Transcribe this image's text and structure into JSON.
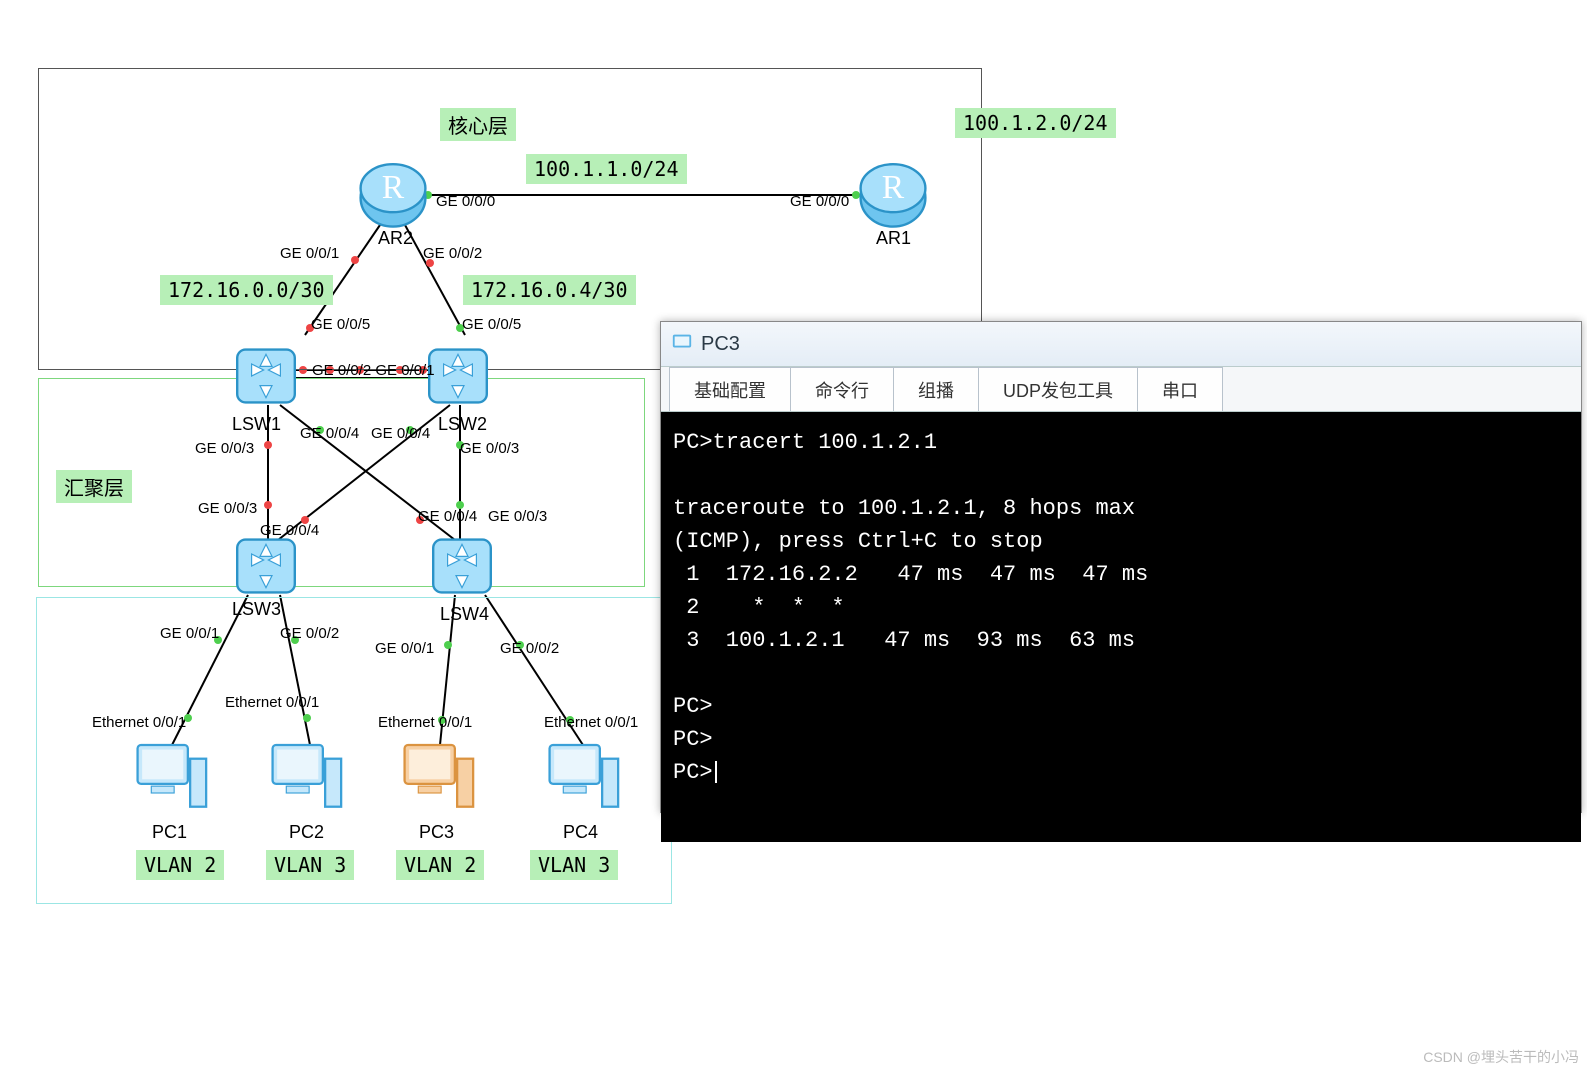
{
  "layers": {
    "core": "核心层",
    "aggregation": "汇聚层"
  },
  "subnets": {
    "ar1_lan": "100.1.2.0/24",
    "ar1_ar2": "100.1.1.0/24",
    "ar2_lsw1": "172.16.0.0/30",
    "ar2_lsw2": "172.16.0.4/30"
  },
  "devices": {
    "ar1": "AR1",
    "ar2": "AR2",
    "lsw1": "LSW1",
    "lsw2": "LSW2",
    "lsw3": "LSW3",
    "lsw4": "LSW4",
    "pc1": "PC1",
    "pc2": "PC2",
    "pc3": "PC3",
    "pc4": "PC4"
  },
  "vlans": {
    "pc1": "VLAN 2",
    "pc2": "VLAN 3",
    "pc3": "VLAN 2",
    "pc4": "VLAN 3"
  },
  "ports": {
    "ar2_ge000": "GE 0/0/0",
    "ar1_ge000": "GE 0/0/0",
    "ar2_ge001": "GE 0/0/1",
    "ar2_ge002": "GE 0/0/2",
    "lsw1_ge005": "GE 0/0/5",
    "lsw2_ge005": "GE 0/0/5",
    "lsw1_ge001": "GE 0/0/1",
    "lsw2_ge001": "GE 0/0/1",
    "lsw1_ge003": "GE 0/0/3",
    "lsw1_ge004": "GE 0/0/4",
    "lsw2_ge003": "GE 0/0/3",
    "lsw2_ge004": "GE 0/0/4",
    "lsw3_ge003": "GE 0/0/3",
    "lsw3_ge004": "GE 0/0/4",
    "lsw4_ge003": "GE 0/0/3",
    "lsw4_ge004": "GE 0/0/4",
    "lsw3_ge001": "GE 0/0/1",
    "lsw3_ge002": "GE 0/0/2",
    "lsw4_ge001": "GE 0/0/1",
    "lsw4_ge002": "GE 0/0/2",
    "pc1_e001": "Ethernet 0/0/1",
    "pc2_e001": "Ethernet 0/0/1",
    "pc3_e001": "Ethernet 0/0/1",
    "pc4_e001": "Ethernet 0/0/1",
    "mid_link": "GE 0/0/2 GE 0/0/1"
  },
  "terminal": {
    "title": "PC3",
    "tabs": [
      "基础配置",
      "命令行",
      "组播",
      "UDP发包工具",
      "串口"
    ],
    "lines": [
      "PC>tracert 100.1.2.1",
      "",
      "traceroute to 100.1.2.1, 8 hops max",
      "(ICMP), press Ctrl+C to stop",
      " 1  172.16.2.2   47 ms  47 ms  47 ms",
      " 2    *  *  *",
      " 3  100.1.2.1   47 ms  93 ms  63 ms",
      "",
      "PC>",
      "PC>",
      "PC>"
    ]
  },
  "watermark": "CSDN @埋头苦干的小冯"
}
